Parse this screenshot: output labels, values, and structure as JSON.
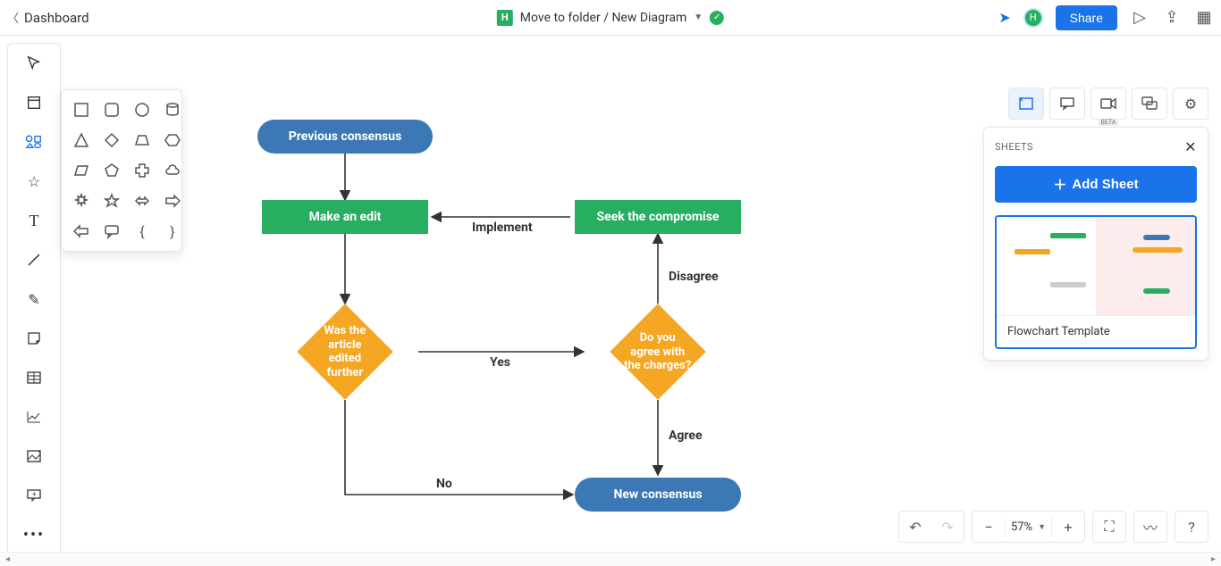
{
  "header": {
    "back_label": "Dashboard",
    "doc_badge": "H",
    "doc_title": "Move to folder / New Diagram",
    "share_label": "Share",
    "avatar_initial": "H"
  },
  "sheets_panel": {
    "heading": "SHEETS",
    "add_label": "Add Sheet",
    "thumb_label": "Flowchart Template"
  },
  "zoom": {
    "value": "57%"
  },
  "right_tools": {
    "beta_tag": "BETA"
  },
  "flow": {
    "nodes": {
      "prev_consensus": "Previous consensus",
      "make_edit": "Make an edit",
      "seek_compromise": "Seek the compromise",
      "article_edited": "Was the article edited further",
      "agree_charges": "Do you agree with the charges?",
      "new_consensus": "New consensus"
    },
    "edges": {
      "implement": "Implement",
      "disagree": "Disagree",
      "yes": "Yes",
      "agree": "Agree",
      "no": "No"
    }
  }
}
